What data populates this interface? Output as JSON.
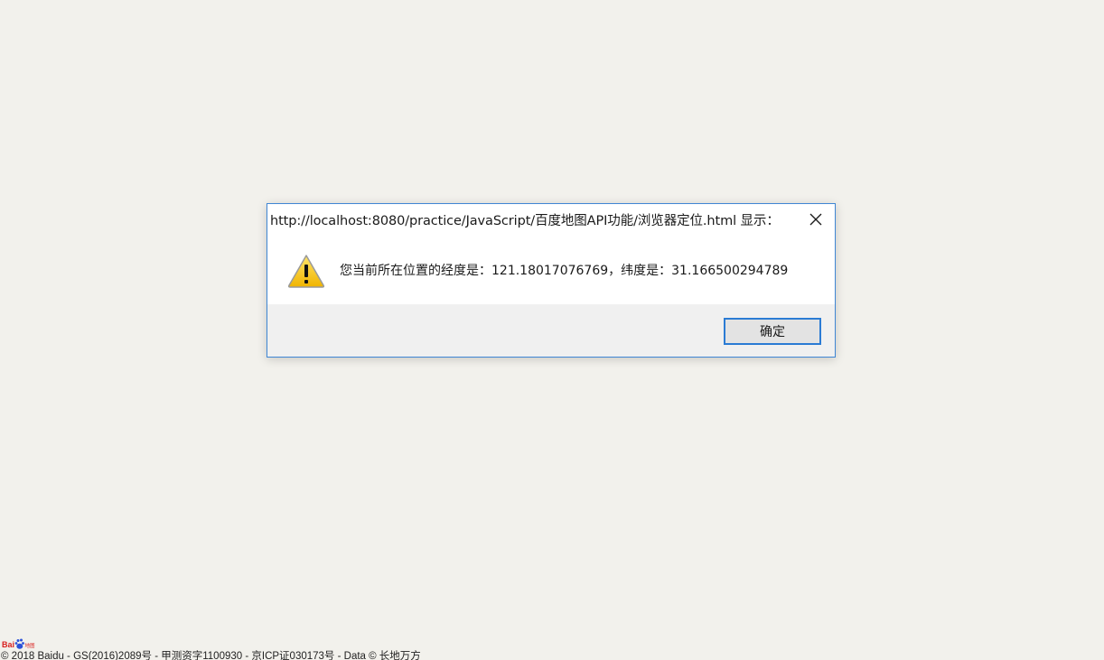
{
  "dialog": {
    "title": "http://localhost:8080/practice/JavaScript/百度地图API功能/浏览器定位.html 显示：",
    "message": "您当前所在位置的经度是：121.18017076769，纬度是：31.166500294789",
    "ok_label": "确定",
    "close_icon": "close-icon",
    "warning_icon": "warning-icon"
  },
  "map": {
    "logo_text": "Bai",
    "logo_suffix": "地图",
    "copyright": "© 2018 Baidu - GS(2016)2089号 - 甲测资字1100930 - 京ICP证030173号 - Data © 长地万方"
  },
  "colors": {
    "background": "#f2f1ec",
    "dialog_border": "#3f86d4",
    "button_border": "#2b7bd4",
    "footer_bg": "#f0f0f0",
    "baidu_red": "#d8201e",
    "baidu_blue": "#2c52d8"
  }
}
